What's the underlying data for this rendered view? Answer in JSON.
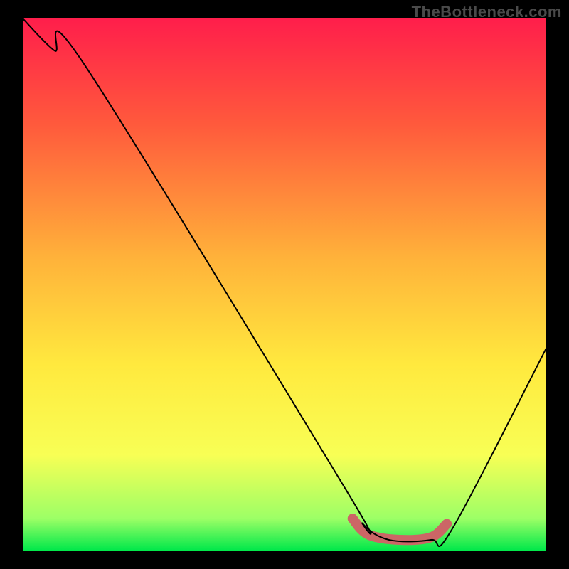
{
  "watermark": "TheBottleneck.com",
  "chart_data": {
    "type": "line",
    "title": "",
    "xlabel": "",
    "ylabel": "",
    "xlim": [
      0,
      100
    ],
    "ylim": [
      0,
      100
    ],
    "gradient_stops": [
      {
        "offset": 0,
        "color": "#FF1E4B"
      },
      {
        "offset": 20,
        "color": "#FF5A3C"
      },
      {
        "offset": 45,
        "color": "#FFB23A"
      },
      {
        "offset": 65,
        "color": "#FFE93E"
      },
      {
        "offset": 82,
        "color": "#F8FF55"
      },
      {
        "offset": 94,
        "color": "#9CFF66"
      },
      {
        "offset": 100,
        "color": "#00E84A"
      }
    ],
    "series": [
      {
        "name": "bottleneck-curve",
        "points": [
          {
            "x": 0,
            "y": 100
          },
          {
            "x": 6,
            "y": 94
          },
          {
            "x": 12,
            "y": 91
          },
          {
            "x": 62,
            "y": 11
          },
          {
            "x": 65,
            "y": 5
          },
          {
            "x": 70,
            "y": 2
          },
          {
            "x": 78,
            "y": 2
          },
          {
            "x": 82,
            "y": 4
          },
          {
            "x": 100,
            "y": 38
          }
        ]
      }
    ],
    "highlight_region": {
      "name": "sweet-spot",
      "points": [
        {
          "x": 63,
          "y": 6
        },
        {
          "x": 66,
          "y": 3
        },
        {
          "x": 72,
          "y": 2
        },
        {
          "x": 78,
          "y": 2.5
        },
        {
          "x": 81,
          "y": 5
        }
      ]
    }
  }
}
